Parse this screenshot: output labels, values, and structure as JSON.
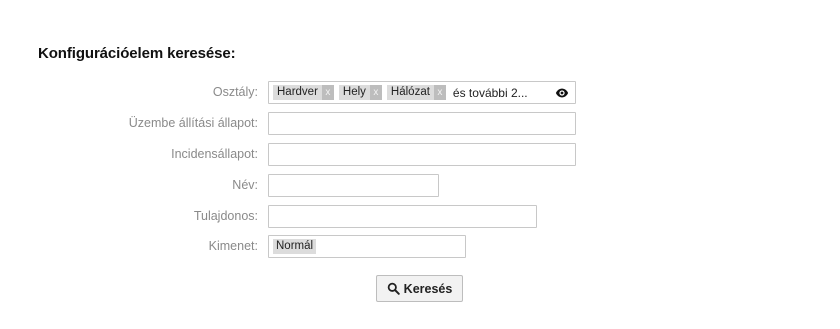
{
  "heading": "Konfigurációelem keresése:",
  "fields": {
    "class": {
      "label": "Osztály:",
      "tags": [
        "Hardver",
        "Hely",
        "Hálózat"
      ],
      "more_text": "és további 2...",
      "remove_glyph": "x"
    },
    "deployment_state": {
      "label": "Üzembe állítási állapot:",
      "value": ""
    },
    "incident_state": {
      "label": "Incidensállapot:",
      "value": ""
    },
    "name": {
      "label": "Név:",
      "value": ""
    },
    "owner": {
      "label": "Tulajdonos:",
      "value": ""
    },
    "result": {
      "label": "Kimenet:",
      "selected": "Normál"
    }
  },
  "search_button": {
    "label": "Keresés",
    "icon": "search-icon"
  }
}
